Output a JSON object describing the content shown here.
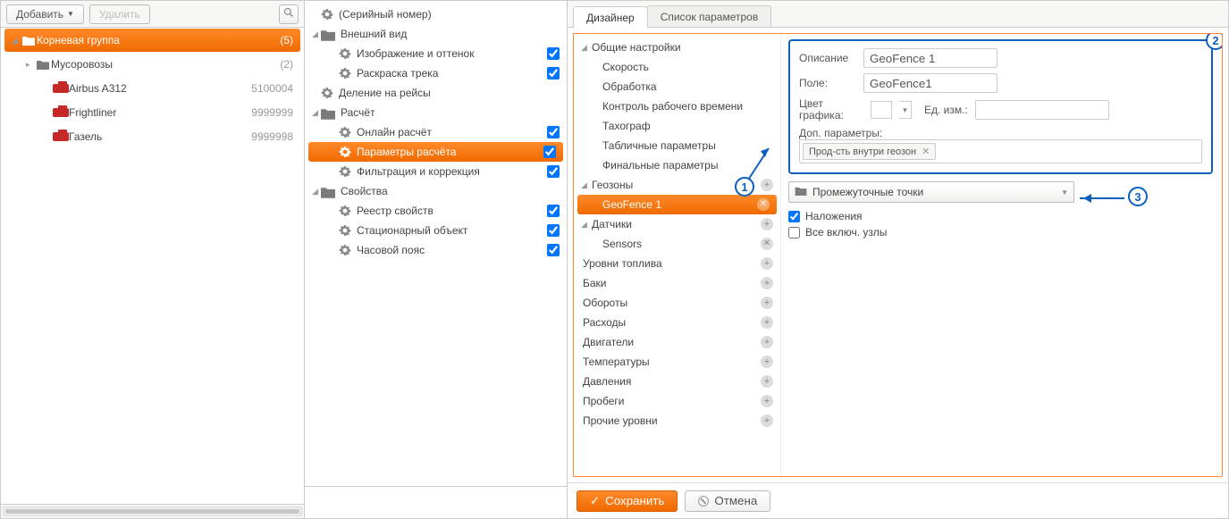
{
  "left": {
    "toolbar": {
      "add": "Добавить",
      "remove": "Удалить"
    },
    "root": {
      "label": "Корневая группа",
      "count": "(5)"
    },
    "group1": {
      "label": "Мусоровозы",
      "count": "(2)"
    },
    "vehicles": [
      {
        "name": "Airbus A312",
        "num": "5100004"
      },
      {
        "name": "Frightliner",
        "num": "9999999"
      },
      {
        "name": "Газель",
        "num": "9999998"
      }
    ]
  },
  "mid": {
    "serial": "(Серийный номер)",
    "appearance": "Внешний вид",
    "image_tint": "Изображение и оттенок",
    "track_paint": "Раскраска трека",
    "trip_split": "Деление на рейсы",
    "calc": "Расчёт",
    "online_calc": "Онлайн расчёт",
    "calc_params": "Параметры расчёта",
    "filter_corr": "Фильтрация и коррекция",
    "props": "Свойства",
    "prop_registry": "Реестр свойств",
    "stationary": "Стационарный объект",
    "timezone": "Часовой пояс"
  },
  "tabs": {
    "designer": "Дизайнер",
    "paramlist": "Список параметров"
  },
  "ptree": {
    "general": "Общие настройки",
    "speed": "Скорость",
    "processing": "Обработка",
    "worktime": "Контроль рабочего времени",
    "tacho": "Тахограф",
    "table_params": "Табличные параметры",
    "final_params": "Финальные параметры",
    "geozones": "Геозоны",
    "geofence1": "GeoFence 1",
    "sensors_head": "Датчики",
    "sensors": "Sensors",
    "fuel_levels": "Уровни топлива",
    "tanks": "Баки",
    "rpm": "Обороты",
    "expenses": "Расходы",
    "engines": "Двигатели",
    "temperatures": "Температуры",
    "pressures": "Давления",
    "mileages": "Пробеги",
    "other_levels": "Прочие уровни"
  },
  "form": {
    "descr_label": "Описание",
    "descr_value": "GeoFence 1",
    "field_label": "Поле:",
    "field_value": "GeoFence1",
    "color_label": "Цвет графика:",
    "unit_label": "Ед. изм.:",
    "extra_label": "Доп. параметры:",
    "chip": "Прод-сть внутри геозон",
    "combo": "Промежуточные точки",
    "overlay": "Наложения",
    "allnodes": "Все включ. узлы"
  },
  "footer": {
    "save": "Сохранить",
    "cancel": "Отмена"
  },
  "annot": {
    "a1": "1",
    "a2": "2",
    "a3": "3"
  }
}
